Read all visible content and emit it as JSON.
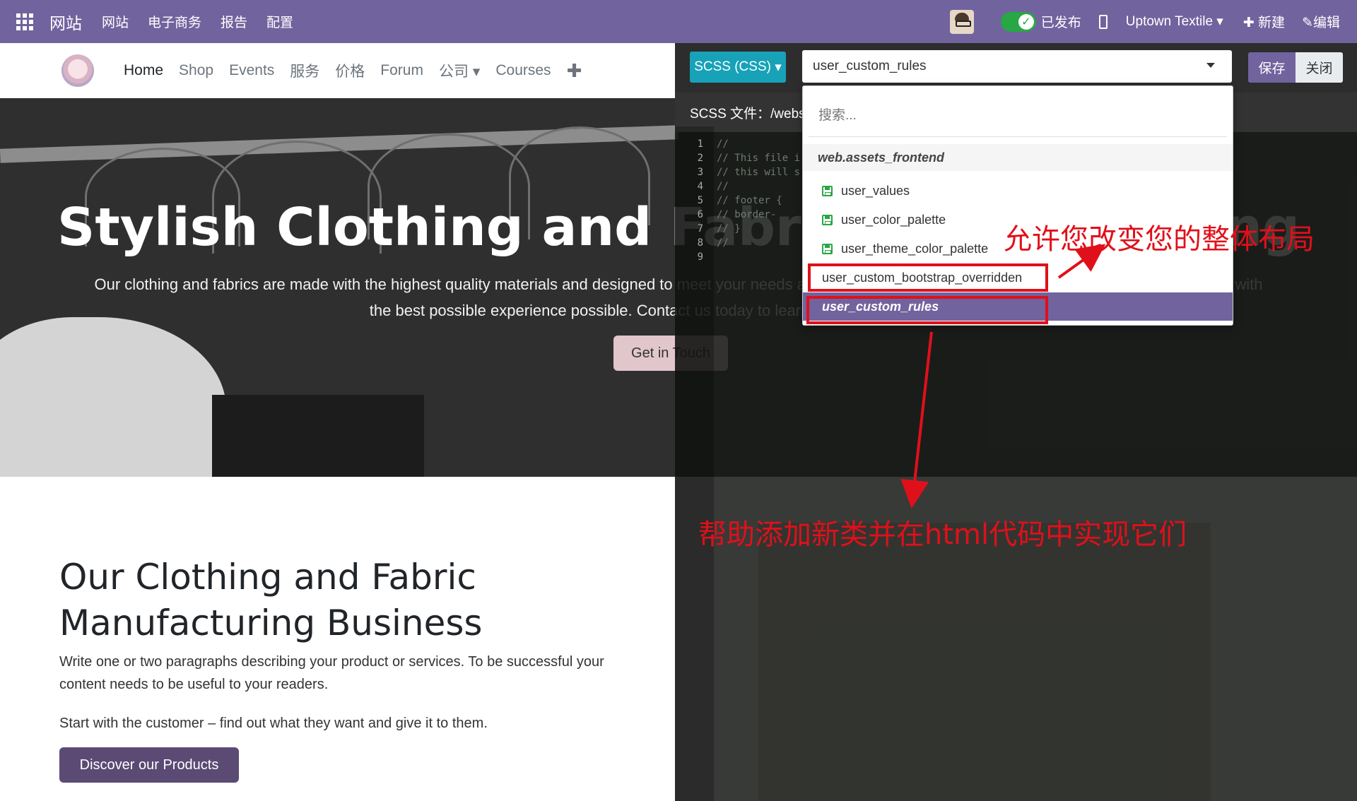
{
  "topbar": {
    "brand": "网站",
    "menu": [
      "网站",
      "电子商务",
      "报告",
      "配置"
    ],
    "published_label": "已发布",
    "site_name": "Uptown Textile",
    "new_label": "新建",
    "edit_label": "编辑"
  },
  "sitenav": {
    "items": [
      "Home",
      "Shop",
      "Events",
      "服务",
      "价格",
      "Forum",
      "公司",
      "Courses"
    ],
    "add_icon": "plus-icon"
  },
  "hero": {
    "title": "Stylish Clothing and Fabric Manufacturing",
    "subtitle": "Our clothing and fabrics are made with the highest quality materials and designed to meet your needs and make you look and feel your best. We strive to provide you with the best possible experience possible. Contact us today to learn more about our products.",
    "button": "Get in Touch"
  },
  "section": {
    "title": "Our Clothing and Fabric Manufacturing Business",
    "p1": "Write one or two paragraphs describing your product or services. To be successful your content needs to be useful to your readers.",
    "p2": "Start with the customer – find out what they want and give it to them.",
    "button": "Discover our Products"
  },
  "editor": {
    "mode_button": "SCSS (CSS)",
    "selected_file": "user_custom_rules",
    "save_label": "保存",
    "close_label": "关闭",
    "file_label": "SCSS 文件：/websi",
    "code_lines": [
      {
        "n": "1",
        "text": "//"
      },
      {
        "n": "2",
        "text": "// This file i"
      },
      {
        "n": "3",
        "text": "// this will s"
      },
      {
        "n": "4",
        "text": "//"
      },
      {
        "n": "5",
        "text": "// footer {"
      },
      {
        "n": "6",
        "text": "//     border-"
      },
      {
        "n": "7",
        "text": "// }"
      },
      {
        "n": "8",
        "text": "//"
      },
      {
        "n": "9",
        "text": ""
      }
    ]
  },
  "dropdown": {
    "search_placeholder": "搜索...",
    "group": "web.assets_frontend",
    "items": [
      {
        "label": "user_values",
        "icon": "save-icon"
      },
      {
        "label": "user_color_palette",
        "icon": "save-icon"
      },
      {
        "label": "user_theme_color_palette",
        "icon": "save-icon"
      },
      {
        "label": "user_custom_bootstrap_overridden",
        "icon": ""
      },
      {
        "label": "user_custom_rules",
        "icon": "",
        "selected": true
      }
    ]
  },
  "annotations": {
    "layout_note": "允许您改变您的整体布局",
    "class_note": "帮助添加新类并在html代码中实现它们"
  },
  "colors": {
    "topbar": "#71639e",
    "scss_button": "#17a2b8",
    "selection": "#71639e",
    "annotation": "#e0101a",
    "published_toggle": "#28a745"
  }
}
